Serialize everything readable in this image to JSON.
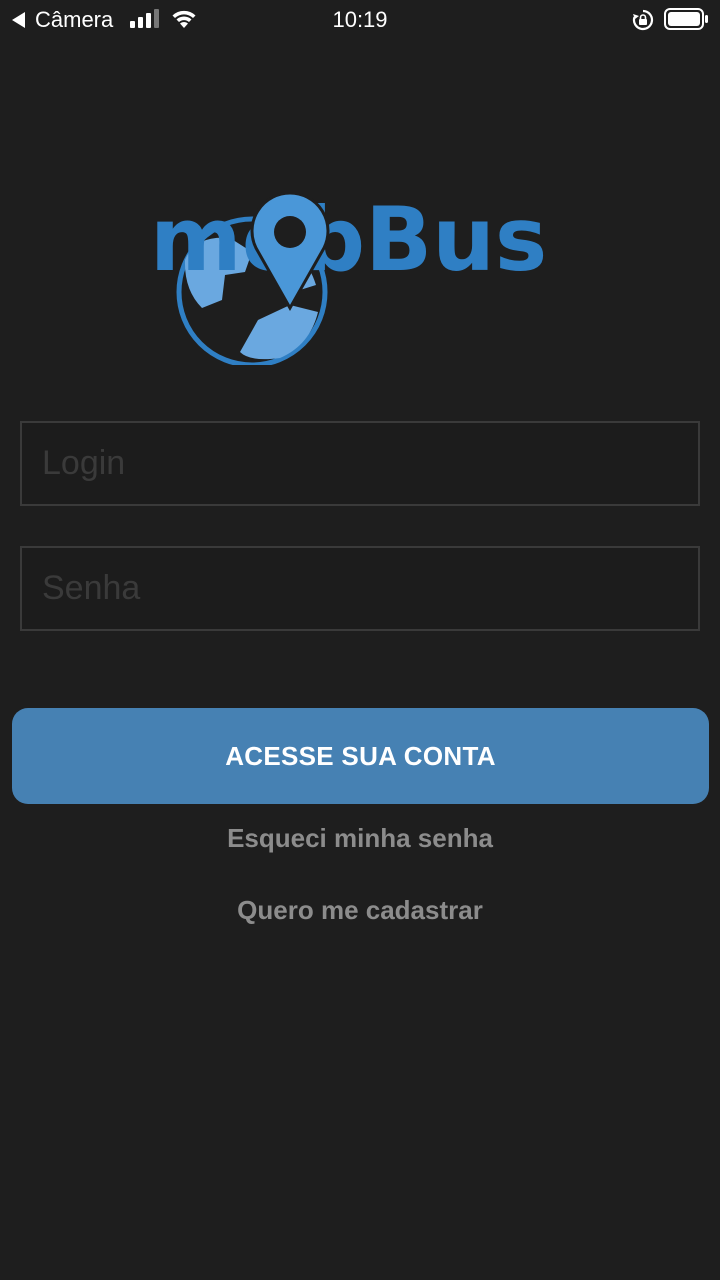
{
  "status_bar": {
    "back_label": "Câmera",
    "time": "10:19",
    "icons": [
      "back-arrow-icon",
      "cellular-signal-icon",
      "wifi-icon",
      "orientation-lock-icon",
      "battery-icon"
    ]
  },
  "logo": {
    "text": "mobBus",
    "color": "#2f7fc4"
  },
  "form": {
    "login_placeholder": "Login",
    "login_value": "",
    "password_placeholder": "Senha",
    "password_value": ""
  },
  "actions": {
    "submit_label": "ACESSE SUA CONTA",
    "forgot_label": "Esqueci minha senha",
    "register_label": "Quero me cadastrar"
  },
  "colors": {
    "background": "#1e1e1e",
    "accent": "#4681b3",
    "link": "#8c8c8c",
    "field_border": "#3a3a3a"
  }
}
